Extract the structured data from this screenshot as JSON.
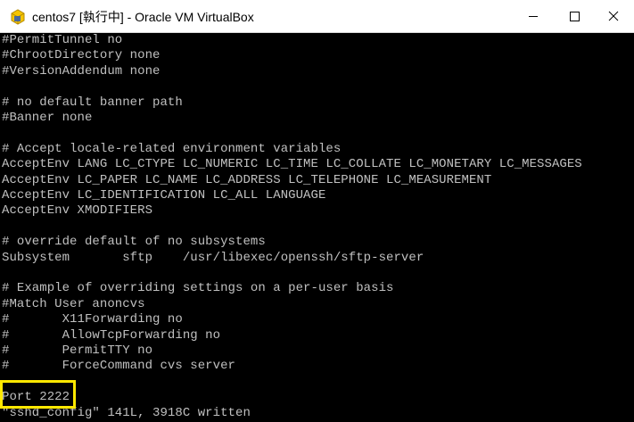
{
  "window": {
    "title": "centos7 [執行中] - Oracle VM VirtualBox",
    "icon": "virtualbox-icon",
    "controls": {
      "minimize": "minimize-icon",
      "maximize": "maximize-icon",
      "close": "close-icon"
    }
  },
  "terminal": {
    "lines": [
      "#PermitTunnel no",
      "#ChrootDirectory none",
      "#VersionAddendum none",
      "",
      "# no default banner path",
      "#Banner none",
      "",
      "# Accept locale-related environment variables",
      "AcceptEnv LANG LC_CTYPE LC_NUMERIC LC_TIME LC_COLLATE LC_MONETARY LC_MESSAGES",
      "AcceptEnv LC_PAPER LC_NAME LC_ADDRESS LC_TELEPHONE LC_MEASUREMENT",
      "AcceptEnv LC_IDENTIFICATION LC_ALL LANGUAGE",
      "AcceptEnv XMODIFIERS",
      "",
      "# override default of no subsystems",
      "Subsystem       sftp    /usr/libexec/openssh/sftp-server",
      "",
      "# Example of overriding settings on a per-user basis",
      "#Match User anoncvs",
      "#       X11Forwarding no",
      "#       AllowTcpForwarding no",
      "#       PermitTTY no",
      "#       ForceCommand cvs server",
      "",
      "Port 2222",
      "\"sshd_config\" 141L, 3918C written"
    ],
    "highlight_color": "#ffe800",
    "text_color": "#c0c0c0",
    "background": "#000000"
  }
}
